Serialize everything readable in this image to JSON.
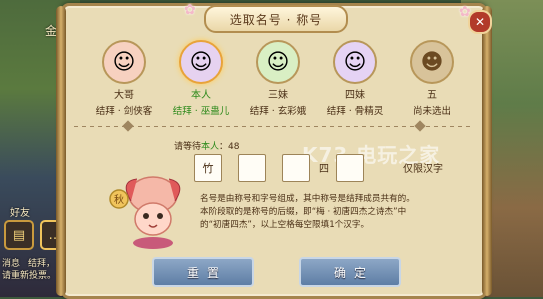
{
  "window": {
    "title": "选取名号 · 称号"
  },
  "background": {
    "left_texts": [
      "金",
      "好友",
      "消息",
      "结拜，",
      "请重新投票。"
    ]
  },
  "avatars": [
    {
      "role": "大哥",
      "tag": "结拜 · 剑侠客",
      "icon": "person-red-hair",
      "self": false
    },
    {
      "role": "本人",
      "tag": "结拜 · 巫蛊儿",
      "icon": "person-purple-hair",
      "self": true
    },
    {
      "role": "三妹",
      "tag": "结拜 · 玄彩娥",
      "icon": "person-green-hair",
      "self": false
    },
    {
      "role": "四妹",
      "tag": "结拜 · 骨精灵",
      "icon": "person-violet-hair",
      "self": false
    },
    {
      "role": "五",
      "tag": "尚未选出",
      "icon": "person-placeholder",
      "self": false
    }
  ],
  "waiting": {
    "prefix": "请等待",
    "highlight": "本人",
    "suffix": "：48"
  },
  "name_inputs": {
    "first_char": "竹",
    "second_char": "",
    "label_4": "四",
    "third_char": "",
    "hint": "仅限汉字"
  },
  "description": [
    "名号是由称号和字号组成，其中称号是结拜成员共有的。",
    "本阶段取的是称号的后缀，即“梅 · 初唐四杰之诗杰”中",
    "的“初唐四杰”，以上空格每空限填1个汉字。"
  ],
  "buttons": {
    "reset": "重置",
    "confirm": "确定"
  },
  "watermark": "K73 电玩之家"
}
